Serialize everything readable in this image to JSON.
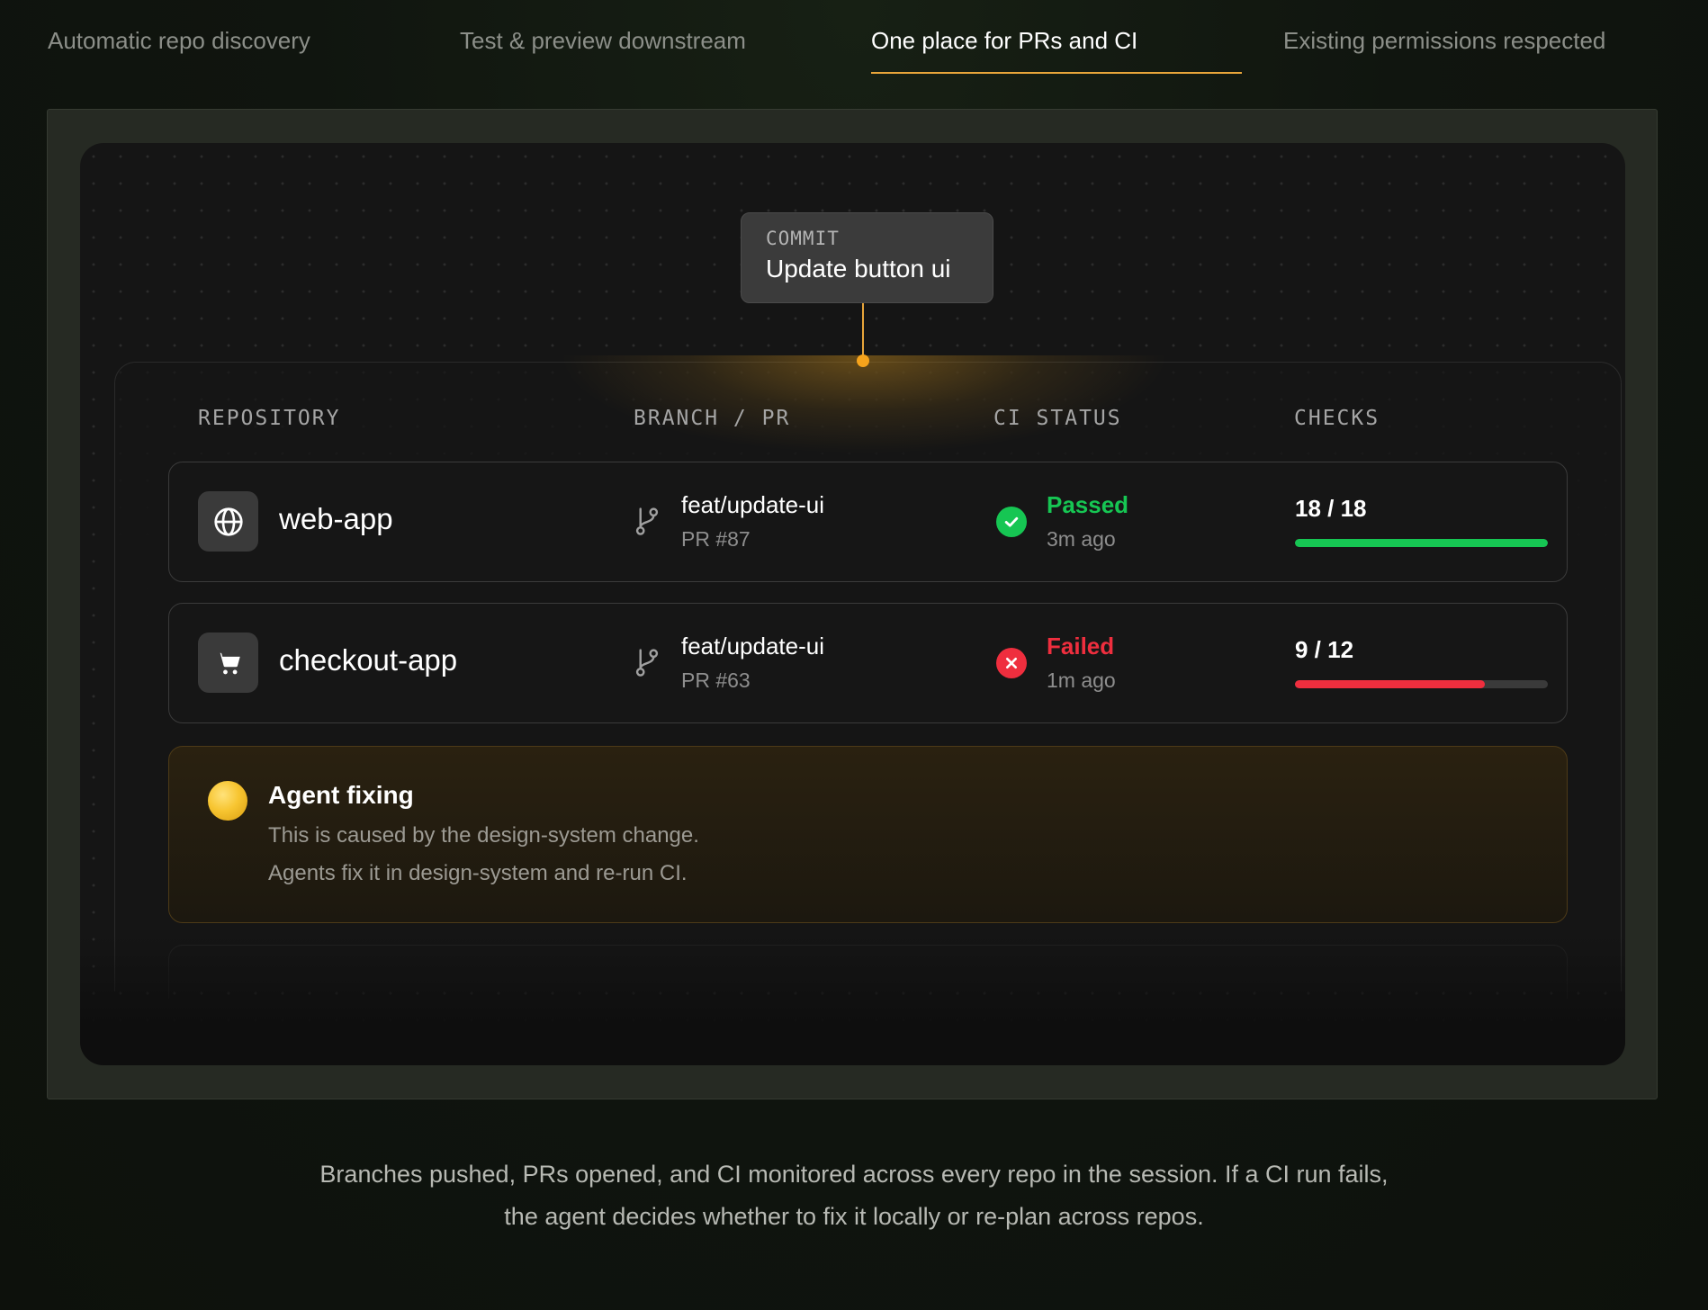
{
  "tabs": [
    {
      "label": "Automatic repo discovery",
      "active": false
    },
    {
      "label": "Test & preview downstream",
      "active": false
    },
    {
      "label": "One place for PRs and CI",
      "active": true
    },
    {
      "label": "Existing permissions respected",
      "active": false
    }
  ],
  "commit": {
    "label": "COMMIT",
    "title": "Update button ui"
  },
  "table": {
    "headers": [
      "REPOSITORY",
      "BRANCH / PR",
      "CI STATUS",
      "CHECKS"
    ],
    "rows": [
      {
        "icon": "globe-icon",
        "repo": "web-app",
        "branch": "feat/update-ui",
        "pr": "PR #87",
        "status": "Passed",
        "status_icon": "check-circle-icon",
        "status_color": "#16c653",
        "time": "3m ago",
        "checks": "18 / 18",
        "checks_passed": 18,
        "checks_total": 18,
        "bar_color": "#16c653"
      },
      {
        "icon": "cart-icon",
        "repo": "checkout-app",
        "branch": "feat/update-ui",
        "pr": "PR #63",
        "status": "Failed",
        "status_icon": "x-circle-icon",
        "status_color": "#ef2e3e",
        "time": "1m ago",
        "checks": "9 / 12",
        "checks_passed": 9,
        "checks_total": 12,
        "bar_color": "#ef2e3e"
      }
    ]
  },
  "agent": {
    "title": "Agent fixing",
    "lines": [
      "This is caused by the design-system change.",
      "Agents fix it in design-system and re-run CI."
    ],
    "color": "#f7c531"
  },
  "caption": {
    "lines": [
      "Branches pushed, PRs opened, and CI monitored across every repo in the session. If a CI run fails,",
      "the agent decides whether to fix it locally or re-plan across repos."
    ]
  },
  "colors": {
    "accent": "#e8a53a",
    "background": "#10150f"
  }
}
